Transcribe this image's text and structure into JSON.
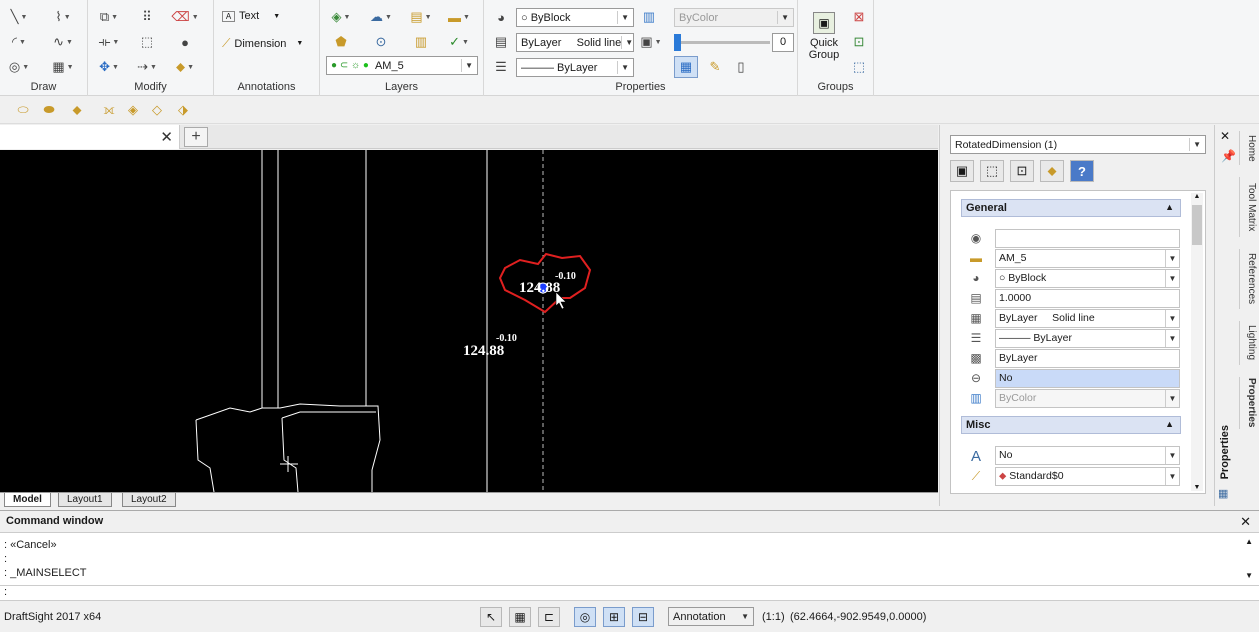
{
  "ribbon": {
    "groups": {
      "draw": "Draw",
      "modify": "Modify",
      "annotations": "Annotations",
      "layers": "Layers",
      "properties": "Properties",
      "groups": "Groups"
    },
    "annotations": {
      "text_label": "Text",
      "dimension_label": "Dimension"
    },
    "layers": {
      "current_layer": "AM_5"
    },
    "properties": {
      "color": "ByBlock",
      "linestyle": "ByLayer     Solid line",
      "lineweight": "——— ByLayer",
      "print_style": "ByColor",
      "transparency": "0"
    },
    "group_tools": {
      "quick_group_label": "Quick Group"
    }
  },
  "canvas": {
    "dimension_a": {
      "text": "124.88",
      "tolerance": "-0.10"
    },
    "dimension_b": {
      "text": "124.88",
      "tolerance": "-0.10"
    }
  },
  "layout_tabs": [
    "Model",
    "Layout1",
    "Layout2"
  ],
  "properties_panel": {
    "selection": "RotatedDimension (1)",
    "general_section": "General",
    "misc_section": "Misc",
    "general": {
      "comment": "",
      "layer": "AM_5",
      "color": "ByBlock",
      "linescale": "1.0000",
      "linestyle": "ByLayer     Solid line",
      "lineweight": "——— ByLayer",
      "transparency": "ByLayer",
      "hyperlink": "No",
      "print_style": "ByColor"
    },
    "misc": {
      "annotative": "No",
      "dimension_style": "Standard$0"
    }
  },
  "side_tabs": [
    "Home",
    "Tool Matrix",
    "References",
    "Lighting",
    "Properties"
  ],
  "side_panel_title": "Properties",
  "command_window": {
    "title": "Command window",
    "lines": [
      ": «Cancel»",
      ":",
      ": _MAINSELECT"
    ],
    "prompt": ":"
  },
  "status_bar": {
    "app_name": "DraftSight 2017 x64",
    "annotation_scale": "Annotation",
    "scale_ratio": "(1:1)",
    "coordinates": "(62.4664,-902.9549,0.0000)"
  },
  "colors": {
    "canvas_bg": "#000000",
    "selection_highlight": "#e02020",
    "grip_blue": "#1a3cff",
    "section_header": "#dbe3f3"
  }
}
